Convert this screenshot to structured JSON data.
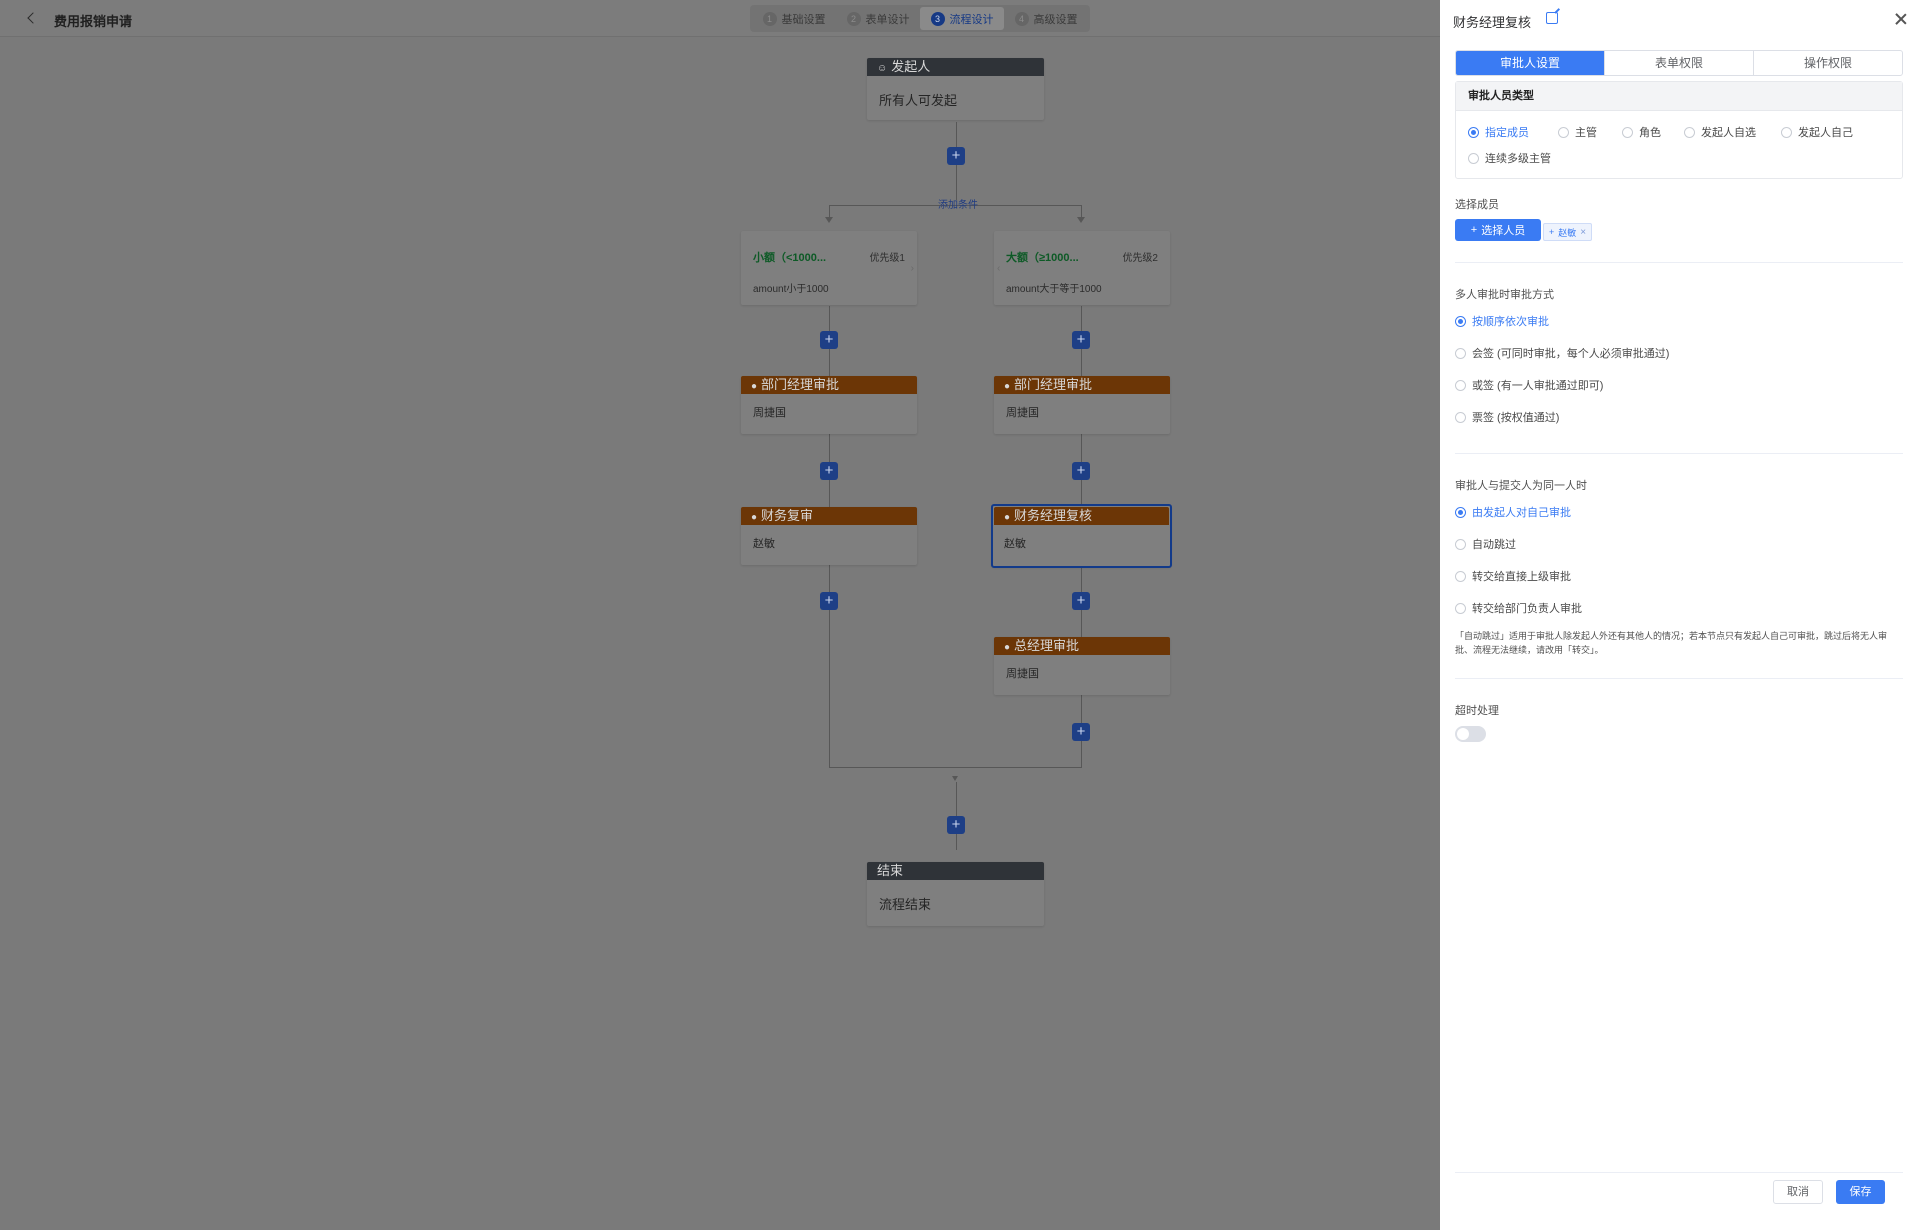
{
  "header": {
    "title": "费用报销申请",
    "steps": [
      {
        "num": "1",
        "label": "基础设置"
      },
      {
        "num": "2",
        "label": "表单设计"
      },
      {
        "num": "3",
        "label": "流程设计"
      },
      {
        "num": "4",
        "label": "高级设置"
      }
    ],
    "active_step": 3
  },
  "flow": {
    "start": {
      "title": "发起人",
      "body": "所有人可发起"
    },
    "add_condition": "添加条件",
    "branches": [
      {
        "condition": {
          "title": "小额（<1000...",
          "priority": "优先级1",
          "expr": "amount小于1000"
        },
        "nodes": [
          {
            "title": "部门经理审批",
            "body": "周捷国"
          },
          {
            "title": "财务复审",
            "body": "赵敏"
          }
        ]
      },
      {
        "condition": {
          "title": "大额（≥1000...",
          "priority": "优先级2",
          "expr": "amount大于等于1000"
        },
        "nodes": [
          {
            "title": "部门经理审批",
            "body": "周捷国"
          },
          {
            "title": "财务经理复核",
            "body": "赵敏"
          },
          {
            "title": "总经理审批",
            "body": "周捷国"
          }
        ]
      }
    ],
    "end": {
      "title": "结束",
      "body": "流程结束"
    }
  },
  "drawer": {
    "title": "财务经理复核",
    "tabs": [
      "审批人设置",
      "表单权限",
      "操作权限"
    ],
    "active_tab": 0,
    "approver_type": {
      "label": "审批人员类型",
      "options": [
        "指定成员",
        "主管",
        "角色",
        "发起人自选",
        "发起人自己",
        "连续多级主管"
      ],
      "selected": 0
    },
    "select_members": {
      "label": "选择成员",
      "button": "选择人员",
      "chip": "赵敏"
    },
    "multi_approve": {
      "label": "多人审批时审批方式",
      "options": [
        "按顺序依次审批",
        "会签 (可同时审批，每个人必须审批通过)",
        "或签 (有一人审批通过即可)",
        "票签 (按权值通过)"
      ],
      "selected": 0
    },
    "same_person": {
      "label": "审批人与提交人为同一人时",
      "options": [
        "由发起人对自己审批",
        "自动跳过",
        "转交给直接上级审批",
        "转交给部门负责人审批"
      ],
      "selected": 0
    },
    "note": "「自动跳过」适用于审批人除发起人外还有其他人的情况；若本节点只有发起人自己可审批，跳过后将无人审批、流程无法继续，请改用「转交」。",
    "timeout": {
      "label": "超时处理",
      "enabled": false
    },
    "cancel": "取消",
    "save": "保存"
  },
  "colors": {
    "primary": "#3a7bf3",
    "approver_header": "#6c3606",
    "start_end_header": "#2f3338",
    "mask": "#7a7a7a"
  }
}
